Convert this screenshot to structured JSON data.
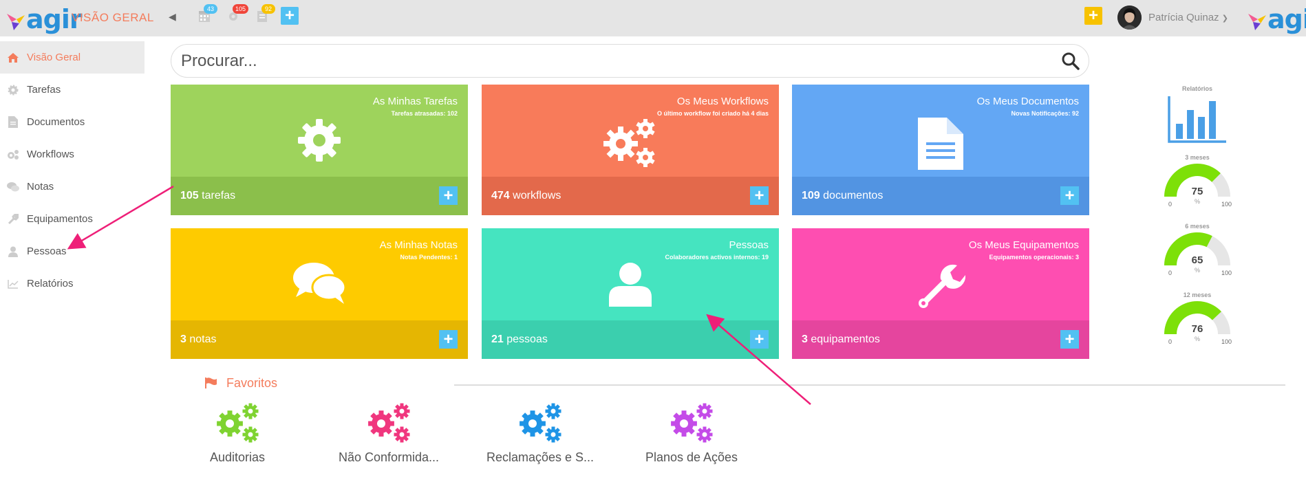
{
  "brand": {
    "logo_text": "agir",
    "accent": "#f47c5c",
    "blue": "#52c1f2"
  },
  "header": {
    "page_title": "VISÃO GERAL",
    "badges": {
      "calendar": "43",
      "tasks": "105",
      "notes": "92"
    },
    "user_name": "Patrícia Quinaz"
  },
  "sidebar": {
    "items": [
      {
        "label": "Visão Geral",
        "icon": "home-icon"
      },
      {
        "label": "Tarefas",
        "icon": "gear-icon"
      },
      {
        "label": "Documentos",
        "icon": "document-icon"
      },
      {
        "label": "Workflows",
        "icon": "gears-icon"
      },
      {
        "label": "Notas",
        "icon": "chat-icon"
      },
      {
        "label": "Equipamentos",
        "icon": "wrench-icon"
      },
      {
        "label": "Pessoas",
        "icon": "user-icon"
      },
      {
        "label": "Relatórios",
        "icon": "chart-line-icon"
      }
    ]
  },
  "search": {
    "placeholder": "Procurar..."
  },
  "tiles": [
    {
      "title": "As Minhas Tarefas",
      "sub": "Tarefas atrasadas: 102",
      "count": "105",
      "unit": "tarefas",
      "color_top": "#9ed35c",
      "color_bottom": "#8bbf4b"
    },
    {
      "title": "Os Meus Workflows",
      "sub": "O último workflow foi criado há 4 dias",
      "count": "474",
      "unit": "workflows",
      "color_top": "#f87b5a",
      "color_bottom": "#e3694b"
    },
    {
      "title": "Os Meus Documentos",
      "sub": "Novas Notificações: 92",
      "count": "109",
      "unit": "documentos",
      "color_top": "#63a7f4",
      "color_bottom": "#5294e2"
    },
    {
      "title": "As Minhas Notas",
      "sub": "Notas Pendentes: 1",
      "count": "3",
      "unit": "notas",
      "color_top": "#fecb00",
      "color_bottom": "#e5b602"
    },
    {
      "title": "Pessoas",
      "sub": "Colaboradores activos internos: 19",
      "count": "21",
      "unit": "pessoas",
      "color_top": "#45e4c0",
      "color_bottom": "#3bcfae"
    },
    {
      "title": "Os Meus Equipamentos",
      "sub": "Equipamentos operacionais: 3",
      "count": "3",
      "unit": "equipamentos",
      "color_top": "#fe4eb1",
      "color_bottom": "#e5459e"
    }
  ],
  "favorites": {
    "title": "Favoritos",
    "items": [
      {
        "label": "Auditorias",
        "color": "#7fd331"
      },
      {
        "label": "Não Conformida...",
        "color": "#f0367e"
      },
      {
        "label": "Reclamações e S...",
        "color": "#1e94e6"
      },
      {
        "label": "Planos de Ações",
        "color": "#c44be8"
      }
    ]
  },
  "reports": {
    "title": "Relatórios",
    "gauges": [
      {
        "label": "3 meses",
        "value": 75,
        "min": "0",
        "max": "100",
        "unit": "%"
      },
      {
        "label": "6 meses",
        "value": 65,
        "min": "0",
        "max": "100",
        "unit": "%"
      },
      {
        "label": "12 meses",
        "value": 76,
        "min": "0",
        "max": "100",
        "unit": "%"
      }
    ]
  }
}
